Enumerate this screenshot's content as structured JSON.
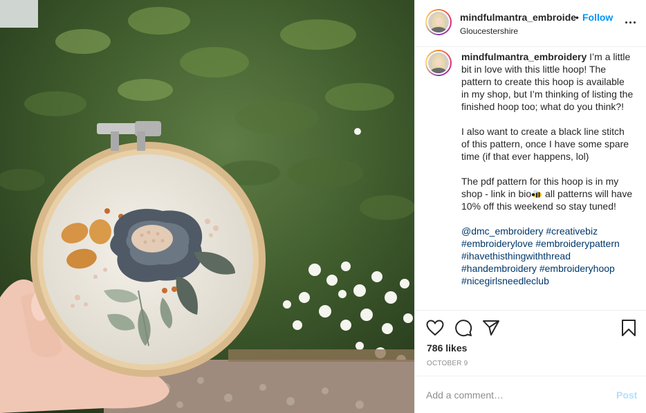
{
  "post": {
    "username": "mindfulmantra_embroide",
    "separator": "•",
    "follow_label": "Follow",
    "location": "Gloucestershire",
    "more_icon": "more-options-icon",
    "photo_alt": "embroidery hoop with grey flower held in front of garden"
  },
  "caption": {
    "username": "mindfulmantra_embroidery",
    "para1": "I’m a little bit in love with this little hoop! The pattern to create this hoop is available in my shop, but I’m thinking of listing the finished hoop too; what do you think?!",
    "para2": "I also want to create a black line stitch of this pattern, once I have some spare time (if that ever happens, lol)",
    "para3a": "The pdf pattern for this hoop is in my shop - link in bio",
    "para3b": " all patterns will have 10% off this weekend so stay tuned!",
    "emoji_icon": "bee-icon",
    "tags": [
      "@dmc_embroidery",
      "#creativebiz",
      "#embroiderylove",
      "#embroiderypattern",
      "#ihavethisthingwiththread",
      "#handembroidery",
      "#embroideryhoop",
      "#nicegirlsneedleclub"
    ]
  },
  "actions": {
    "like_icon": "heart-icon",
    "comment_icon": "comment-icon",
    "share_icon": "share-icon",
    "save_icon": "bookmark-icon",
    "likes": "786 likes",
    "date": "OCTOBER 9"
  },
  "comment_box": {
    "placeholder": "Add a comment…",
    "post_label": "Post",
    "accent_disabled": "#b2dffc"
  },
  "colors": {
    "link": "#0095f6",
    "hashtag": "#00376b",
    "muted": "#8e8e8e",
    "text": "#262626"
  }
}
